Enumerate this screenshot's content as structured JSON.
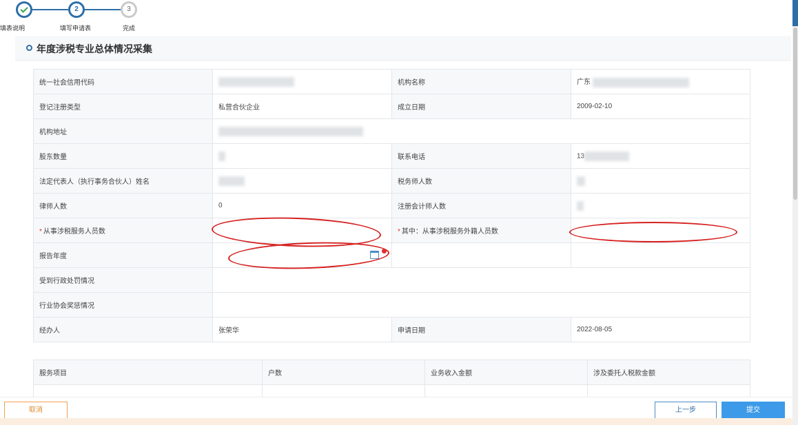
{
  "stepper": {
    "steps": [
      {
        "number": "1",
        "label": "填表说明",
        "state": "done"
      },
      {
        "number": "2",
        "label": "填写申请表",
        "state": "current"
      },
      {
        "number": "3",
        "label": "完成",
        "state": "todo"
      }
    ]
  },
  "section": {
    "title": "年度涉税专业总体情况采集"
  },
  "form": {
    "credit_code_label": "统一社会信用代码",
    "org_name_label": "机构名称",
    "org_name_value": "广东",
    "reg_type_label": "登记注册类型",
    "reg_type_value": "私营合伙企业",
    "founded_label": "成立日期",
    "founded_value": "2009-02-10",
    "address_label": "机构地址",
    "shareholders_label": "股东数量",
    "phone_label": "联系电话",
    "phone_value": "13",
    "legal_rep_label": "法定代表人（执行事务合伙人）姓名",
    "tax_agents_label": "税务师人数",
    "lawyers_label": "律师人数",
    "lawyers_value": "0",
    "cpa_label": "注册会计师人数",
    "tax_staff_label": "从事涉税服务人员数",
    "foreign_staff_label": "其中：从事涉税服务外籍人员数",
    "report_year_label": "报告年度",
    "penalty_label": "受到行政处罚情况",
    "awards_label": "行业协会奖惩情况",
    "handler_label": "经办人",
    "handler_value": "张荣华",
    "apply_date_label": "申请日期",
    "apply_date_value": "2022-08-05",
    "required_mark": "*"
  },
  "service_table": {
    "headers": [
      "服务项目",
      "户数",
      "业务收入金额",
      "涉及委托人税款金额"
    ]
  },
  "footer": {
    "cancel_label": "取消",
    "prev_label": "上一步",
    "submit_label": "提交"
  },
  "colors": {
    "primary": "#2c6ea8",
    "submit": "#3c9ae8",
    "cancel": "#e08a30",
    "annotation": "#d62020"
  }
}
